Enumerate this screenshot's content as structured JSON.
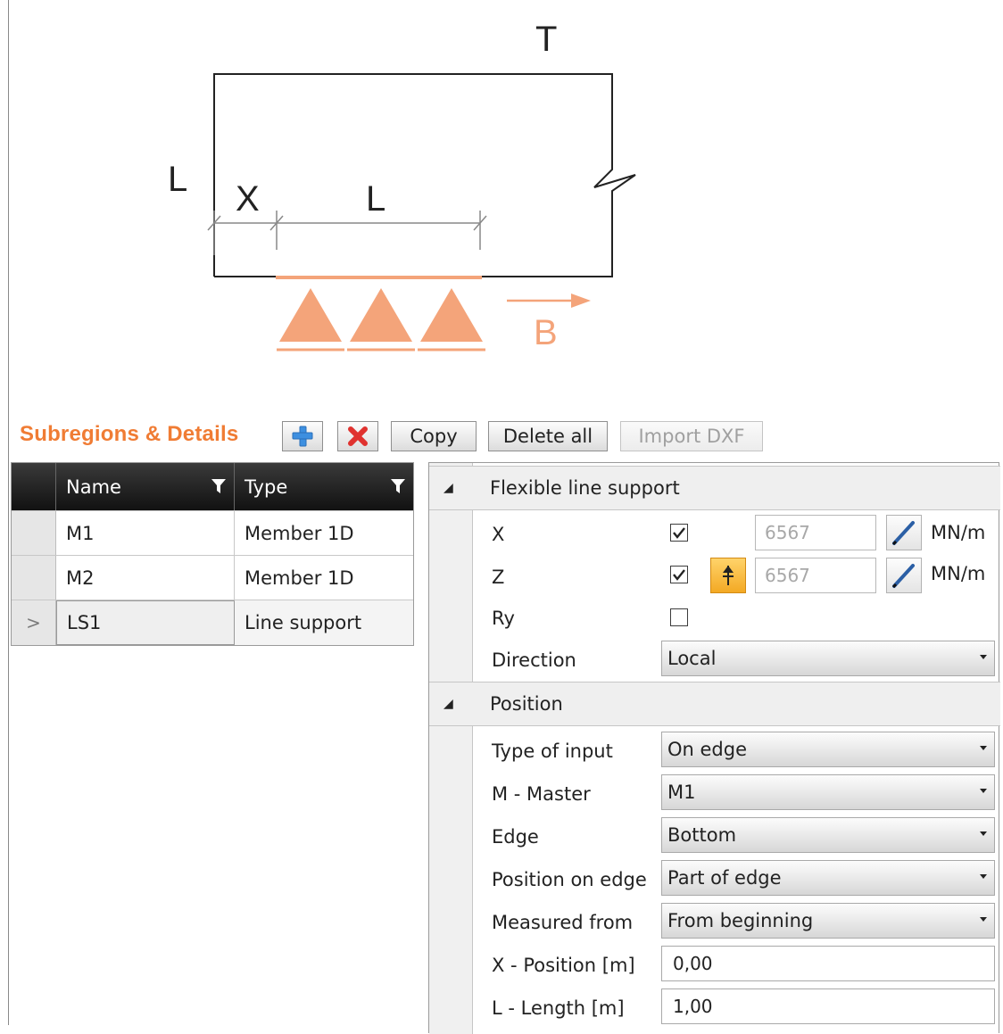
{
  "diagram": {
    "labels": {
      "top": "T",
      "left": "L",
      "dim_x": "X",
      "dim_l": "L",
      "direction": "B"
    },
    "colors": {
      "support": "#f4a47a",
      "outline": "#222222"
    }
  },
  "toolbar": {
    "title": "Subregions & Details",
    "add_icon": "plus-icon",
    "delete_icon": "x-icon",
    "copy_label": "Copy",
    "delete_all_label": "Delete all",
    "import_dxf_label": "Import DXF",
    "accent": "#f07c34"
  },
  "grid": {
    "columns": [
      {
        "label": "Name"
      },
      {
        "label": "Type"
      }
    ],
    "rows": [
      {
        "name": "M1",
        "type": "Member 1D",
        "selected": false
      },
      {
        "name": "M2",
        "type": "Member 1D",
        "selected": false
      },
      {
        "name": "LS1",
        "type": "Line support",
        "selected": true
      }
    ],
    "selected_marker": ">"
  },
  "properties": {
    "support_category": "Flexible line support",
    "x_label": "X",
    "x_checked": true,
    "x_value": "6567",
    "x_unit": "MN/m",
    "z_label": "Z",
    "z_checked": true,
    "z_value": "6567",
    "z_unit": "MN/m",
    "ry_label": "Ry",
    "ry_checked": false,
    "direction_label": "Direction",
    "direction_value": "Local",
    "position_category": "Position",
    "type_of_input_label": "Type of input",
    "type_of_input_value": "On edge",
    "master_label": "M - Master",
    "master_value": "M1",
    "edge_label": "Edge",
    "edge_value": "Bottom",
    "position_on_edge_label": "Position on edge",
    "position_on_edge_value": "Part of edge",
    "measured_from_label": "Measured from",
    "measured_from_value": "From beginning",
    "x_position_label": "X - Position [m]",
    "x_position_value": "0,00",
    "length_label": "L - Length [m]",
    "length_value": "1,00"
  }
}
